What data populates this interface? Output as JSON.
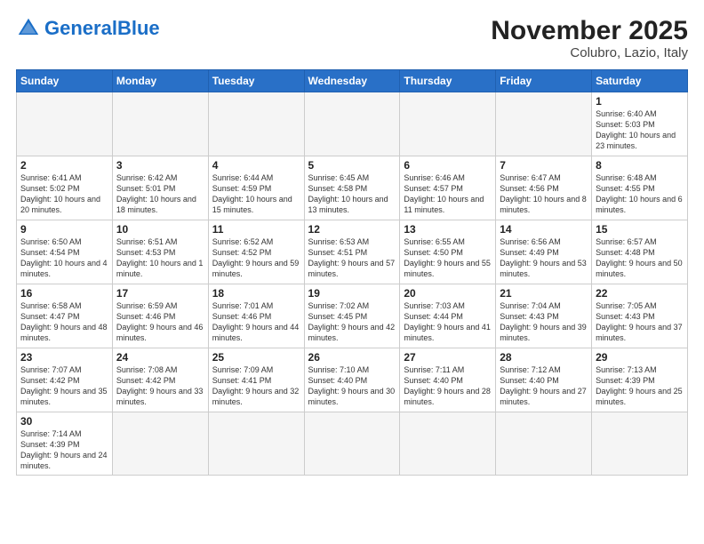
{
  "header": {
    "logo_general": "General",
    "logo_blue": "Blue",
    "month_year": "November 2025",
    "location": "Colubro, Lazio, Italy"
  },
  "days_of_week": [
    "Sunday",
    "Monday",
    "Tuesday",
    "Wednesday",
    "Thursday",
    "Friday",
    "Saturday"
  ],
  "weeks": [
    [
      {
        "day": "",
        "info": ""
      },
      {
        "day": "",
        "info": ""
      },
      {
        "day": "",
        "info": ""
      },
      {
        "day": "",
        "info": ""
      },
      {
        "day": "",
        "info": ""
      },
      {
        "day": "",
        "info": ""
      },
      {
        "day": "1",
        "info": "Sunrise: 6:40 AM\nSunset: 5:03 PM\nDaylight: 10 hours and 23 minutes."
      }
    ],
    [
      {
        "day": "2",
        "info": "Sunrise: 6:41 AM\nSunset: 5:02 PM\nDaylight: 10 hours and 20 minutes."
      },
      {
        "day": "3",
        "info": "Sunrise: 6:42 AM\nSunset: 5:01 PM\nDaylight: 10 hours and 18 minutes."
      },
      {
        "day": "4",
        "info": "Sunrise: 6:44 AM\nSunset: 4:59 PM\nDaylight: 10 hours and 15 minutes."
      },
      {
        "day": "5",
        "info": "Sunrise: 6:45 AM\nSunset: 4:58 PM\nDaylight: 10 hours and 13 minutes."
      },
      {
        "day": "6",
        "info": "Sunrise: 6:46 AM\nSunset: 4:57 PM\nDaylight: 10 hours and 11 minutes."
      },
      {
        "day": "7",
        "info": "Sunrise: 6:47 AM\nSunset: 4:56 PM\nDaylight: 10 hours and 8 minutes."
      },
      {
        "day": "8",
        "info": "Sunrise: 6:48 AM\nSunset: 4:55 PM\nDaylight: 10 hours and 6 minutes."
      }
    ],
    [
      {
        "day": "9",
        "info": "Sunrise: 6:50 AM\nSunset: 4:54 PM\nDaylight: 10 hours and 4 minutes."
      },
      {
        "day": "10",
        "info": "Sunrise: 6:51 AM\nSunset: 4:53 PM\nDaylight: 10 hours and 1 minute."
      },
      {
        "day": "11",
        "info": "Sunrise: 6:52 AM\nSunset: 4:52 PM\nDaylight: 9 hours and 59 minutes."
      },
      {
        "day": "12",
        "info": "Sunrise: 6:53 AM\nSunset: 4:51 PM\nDaylight: 9 hours and 57 minutes."
      },
      {
        "day": "13",
        "info": "Sunrise: 6:55 AM\nSunset: 4:50 PM\nDaylight: 9 hours and 55 minutes."
      },
      {
        "day": "14",
        "info": "Sunrise: 6:56 AM\nSunset: 4:49 PM\nDaylight: 9 hours and 53 minutes."
      },
      {
        "day": "15",
        "info": "Sunrise: 6:57 AM\nSunset: 4:48 PM\nDaylight: 9 hours and 50 minutes."
      }
    ],
    [
      {
        "day": "16",
        "info": "Sunrise: 6:58 AM\nSunset: 4:47 PM\nDaylight: 9 hours and 48 minutes."
      },
      {
        "day": "17",
        "info": "Sunrise: 6:59 AM\nSunset: 4:46 PM\nDaylight: 9 hours and 46 minutes."
      },
      {
        "day": "18",
        "info": "Sunrise: 7:01 AM\nSunset: 4:46 PM\nDaylight: 9 hours and 44 minutes."
      },
      {
        "day": "19",
        "info": "Sunrise: 7:02 AM\nSunset: 4:45 PM\nDaylight: 9 hours and 42 minutes."
      },
      {
        "day": "20",
        "info": "Sunrise: 7:03 AM\nSunset: 4:44 PM\nDaylight: 9 hours and 41 minutes."
      },
      {
        "day": "21",
        "info": "Sunrise: 7:04 AM\nSunset: 4:43 PM\nDaylight: 9 hours and 39 minutes."
      },
      {
        "day": "22",
        "info": "Sunrise: 7:05 AM\nSunset: 4:43 PM\nDaylight: 9 hours and 37 minutes."
      }
    ],
    [
      {
        "day": "23",
        "info": "Sunrise: 7:07 AM\nSunset: 4:42 PM\nDaylight: 9 hours and 35 minutes."
      },
      {
        "day": "24",
        "info": "Sunrise: 7:08 AM\nSunset: 4:42 PM\nDaylight: 9 hours and 33 minutes."
      },
      {
        "day": "25",
        "info": "Sunrise: 7:09 AM\nSunset: 4:41 PM\nDaylight: 9 hours and 32 minutes."
      },
      {
        "day": "26",
        "info": "Sunrise: 7:10 AM\nSunset: 4:40 PM\nDaylight: 9 hours and 30 minutes."
      },
      {
        "day": "27",
        "info": "Sunrise: 7:11 AM\nSunset: 4:40 PM\nDaylight: 9 hours and 28 minutes."
      },
      {
        "day": "28",
        "info": "Sunrise: 7:12 AM\nSunset: 4:40 PM\nDaylight: 9 hours and 27 minutes."
      },
      {
        "day": "29",
        "info": "Sunrise: 7:13 AM\nSunset: 4:39 PM\nDaylight: 9 hours and 25 minutes."
      }
    ],
    [
      {
        "day": "30",
        "info": "Sunrise: 7:14 AM\nSunset: 4:39 PM\nDaylight: 9 hours and 24 minutes."
      },
      {
        "day": "",
        "info": ""
      },
      {
        "day": "",
        "info": ""
      },
      {
        "day": "",
        "info": ""
      },
      {
        "day": "",
        "info": ""
      },
      {
        "day": "",
        "info": ""
      },
      {
        "day": "",
        "info": ""
      }
    ]
  ]
}
